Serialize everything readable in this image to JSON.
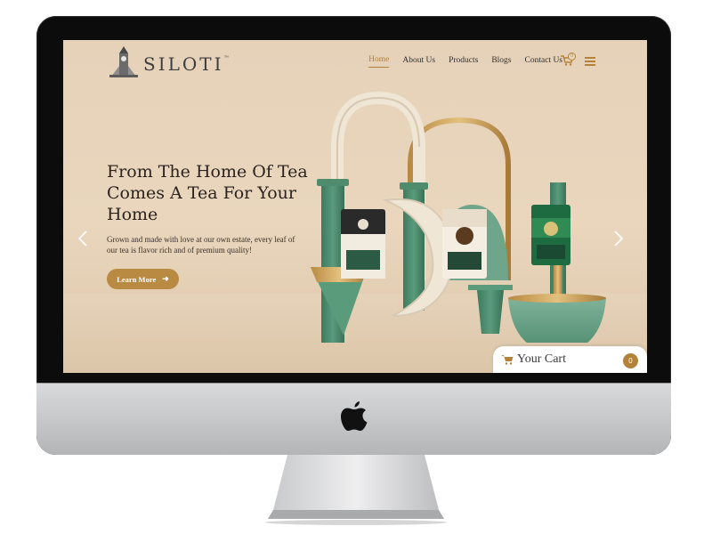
{
  "brand": {
    "name": "SILOTI",
    "trademark": "™"
  },
  "nav": {
    "items": [
      {
        "label": "Home",
        "active": true
      },
      {
        "label": "About Us",
        "active": false
      },
      {
        "label": "Products",
        "active": false
      },
      {
        "label": "Blogs",
        "active": false
      },
      {
        "label": "Contact Us",
        "active": false
      }
    ],
    "cart_count": "0",
    "cart_icon": "cart-icon",
    "menu_icon": "hamburger-icon"
  },
  "hero": {
    "title": "From The Home Of Tea Comes A Tea For Your Home",
    "subtitle": "Grown and made with love at our own estate, every leaf of our tea is flavor rich and of premium quality!",
    "cta_label": "Learn More",
    "cta_icon": "arrow-right-icon",
    "prev_icon": "chevron-left-icon",
    "next_icon": "chevron-right-icon"
  },
  "cart_widget": {
    "label": "Your Cart",
    "count": "0",
    "icon": "cart-icon"
  },
  "colors": {
    "accent": "#b3823a",
    "button": "#b98a42",
    "background": "#e6d2b9",
    "green": "#4f8c6e",
    "text": "#2b2320"
  }
}
